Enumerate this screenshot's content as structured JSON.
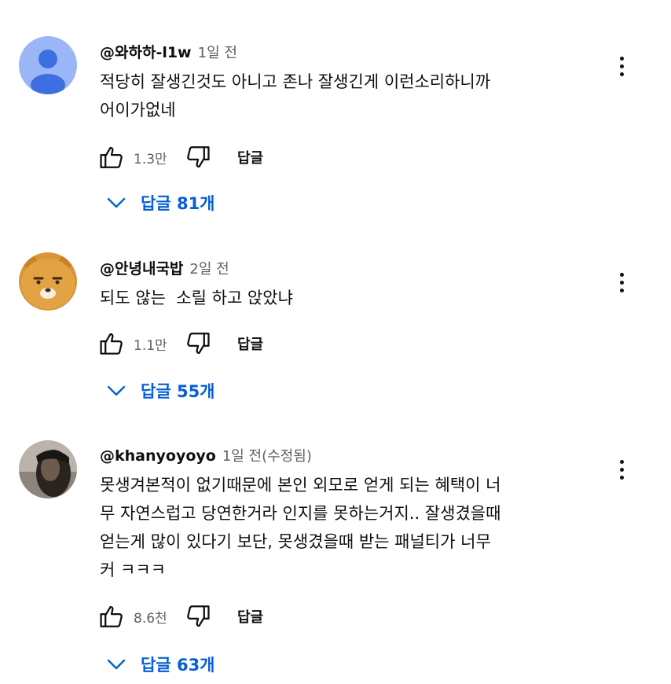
{
  "colors": {
    "link": "#065fd4",
    "secondary_text": "#606060",
    "primary_text": "#0f0f0f"
  },
  "comments": [
    {
      "author": "@와하하-l1w",
      "time": "1일 전",
      "text": "적당히 잘생긴것도 아니고 존나 잘생긴게 이런소리하니까\n어이가없네",
      "likes": "1.3만",
      "reply_label": "답글",
      "replies_label": "답글 81개",
      "avatar_icon": "default-user-avatar"
    },
    {
      "author": "@안녕내국밥",
      "time": "2일 전",
      "text": "되도 않는  소릴 하고 앉았냐",
      "likes": "1.1만",
      "reply_label": "답글",
      "replies_label": "답글 55개",
      "avatar_icon": "bear-face-avatar"
    },
    {
      "author": "@khanyoyoyo",
      "time": "1일 전(수정됨)",
      "text": "못생겨본적이 없기때문에 본인 외모로 얻게 되는 혜택이 너\n무 자연스럽고 당연한거라 인지를 못하는거지.. 잘생겼을때\n얻는게 많이 있다기 보단, 못생겼을때 받는 패널티가 너무\n커 ㅋㅋㅋ",
      "likes": "8.6천",
      "reply_label": "답글",
      "replies_label": "답글 63개",
      "avatar_icon": "dark-photo-avatar"
    }
  ]
}
